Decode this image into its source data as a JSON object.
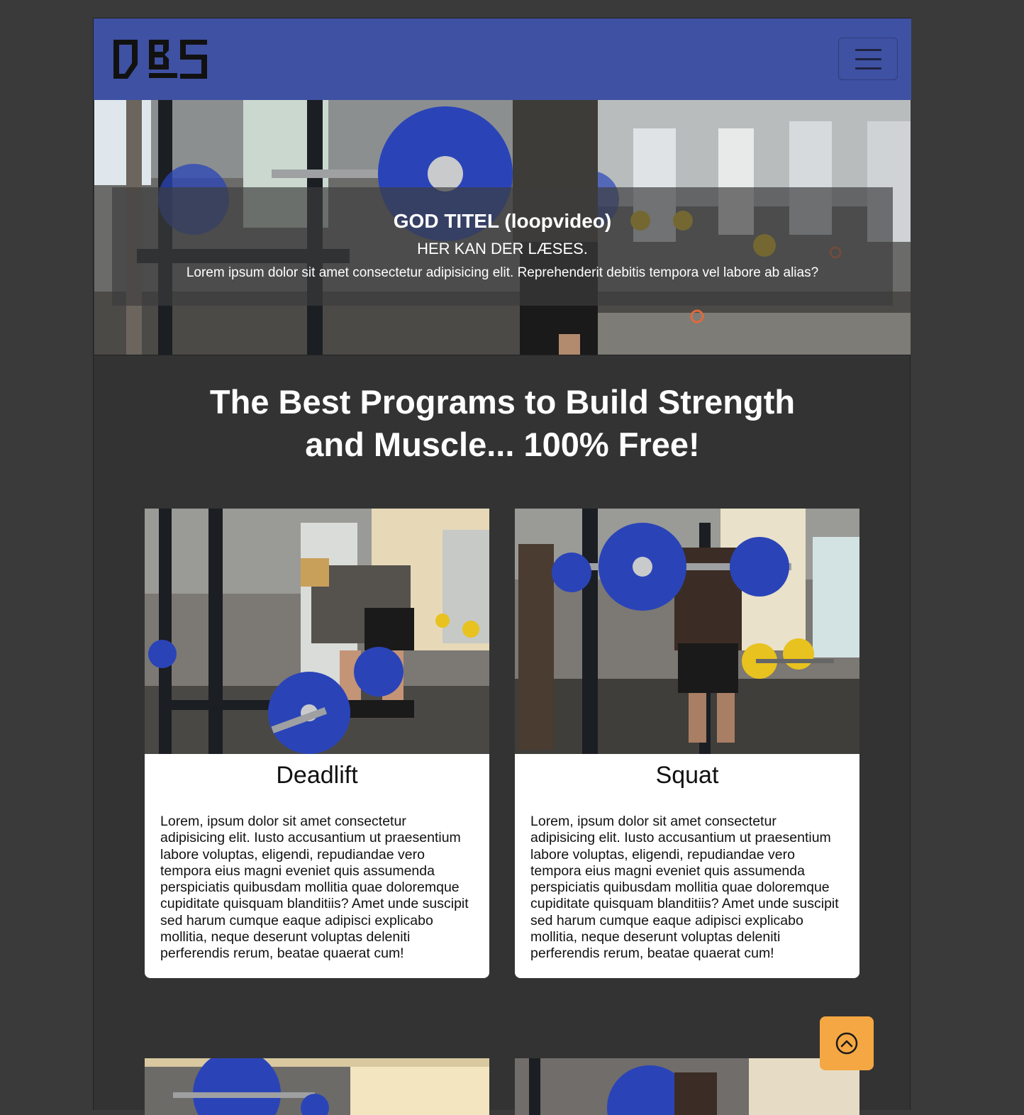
{
  "navbar": {
    "logo_text": "DBS",
    "toggler_icon": "hamburger-icon"
  },
  "hero": {
    "title": "GOD TITEL (loopvideo)",
    "subtitle": "HER KAN DER LÆSES.",
    "text": "Lorem ipsum dolor sit amet consectetur adipisicing elit. Reprehenderit debitis tempora vel labore ab alias?"
  },
  "main": {
    "heading_line1": "The Best Programs to Build Strength",
    "heading_line2": "and Muscle... 100% Free!"
  },
  "cards": [
    {
      "title": "Deadlift",
      "text": "Lorem, ipsum dolor sit amet consectetur adipisicing elit. Iusto accusantium ut praesentium labore voluptas, eligendi, repudiandae vero tempora eius magni eveniet quis assumenda perspiciatis quibusdam mollitia quae doloremque cupiditate quisquam blanditiis? Amet unde suscipit sed harum cumque eaque adipisci explicabo mollitia, neque deserunt voluptas deleniti perferendis rerum, beatae quaerat cum!"
    },
    {
      "title": "Squat",
      "text": "Lorem, ipsum dolor sit amet consectetur adipisicing elit. Iusto accusantium ut praesentium labore voluptas, eligendi, repudiandae vero tempora eius magni eveniet quis assumenda perspiciatis quibusdam mollitia quae doloremque cupiditate quisquam blanditiis? Amet unde suscipit sed harum cumque eaque adipisci explicabo mollitia, neque deserunt voluptas deleniti perferendis rerum, beatae quaerat cum!"
    }
  ],
  "scroll_top": {
    "icon": "chevron-up-circle-icon"
  },
  "colors": {
    "navbar": "#3f51a3",
    "background": "#333333",
    "scroll_button": "#f4a742",
    "plate_blue": "#2a44b8",
    "plate_yellow": "#e8c21e"
  }
}
